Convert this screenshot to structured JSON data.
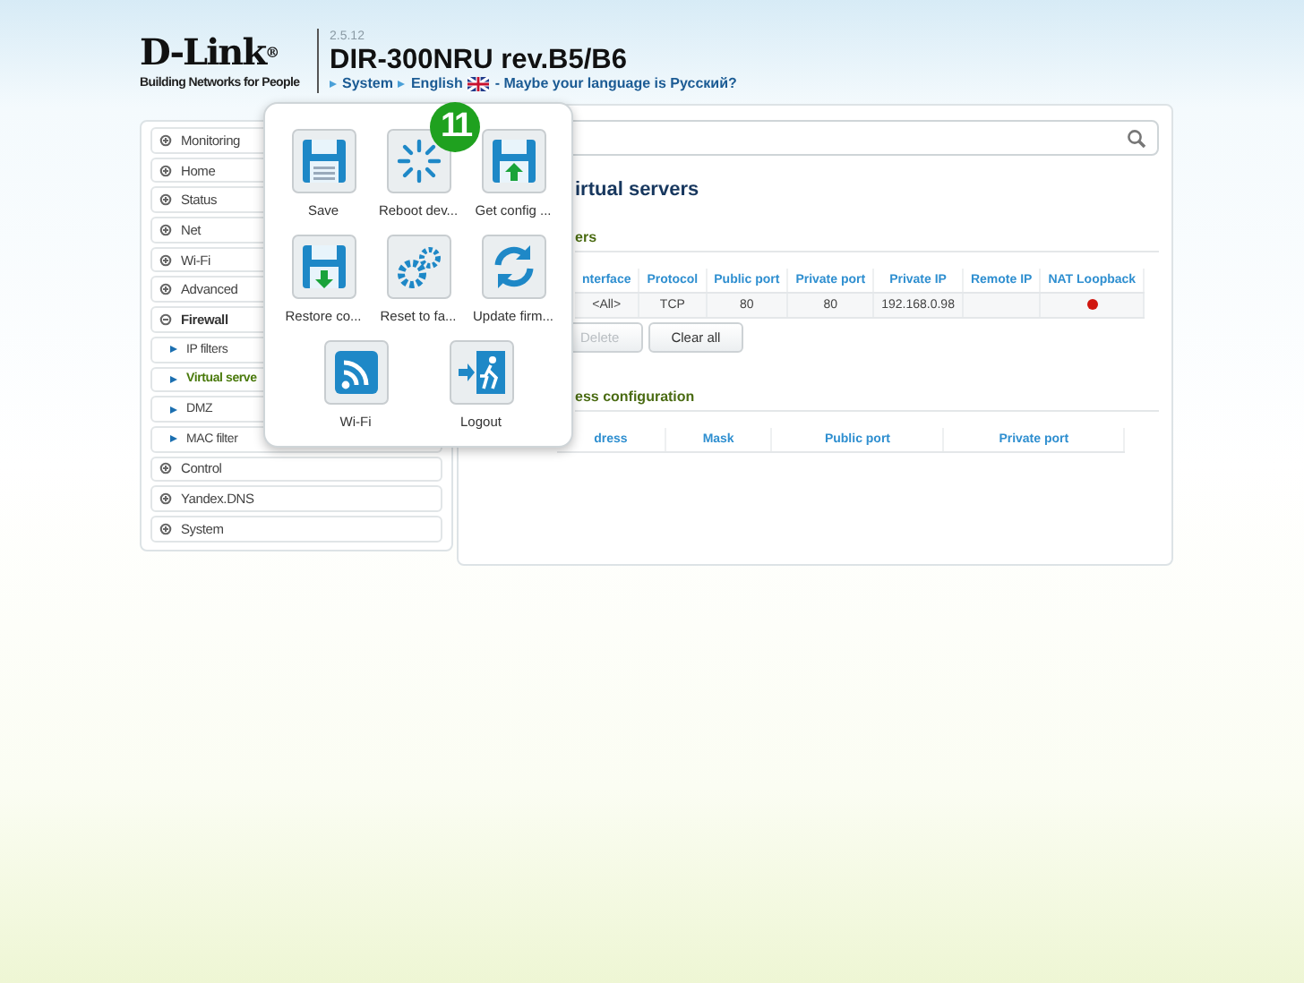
{
  "header": {
    "logo": "D-Link",
    "registered": "®",
    "tagline": "Building Networks for People",
    "version": "2.5.12",
    "model": "DIR-300NRU rev.B5/B6",
    "breadcrumbs": [
      "System",
      "English"
    ],
    "language_hint": "- Maybe your language is Русский?"
  },
  "sidebar": {
    "items": [
      {
        "label": "Monitoring",
        "expanded": false,
        "selected": false
      },
      {
        "label": "Home",
        "expanded": false,
        "selected": false
      },
      {
        "label": "Status",
        "expanded": false,
        "selected": false
      },
      {
        "label": "Net",
        "expanded": false,
        "selected": false
      },
      {
        "label": "Wi-Fi",
        "expanded": false,
        "selected": false
      },
      {
        "label": "Advanced",
        "expanded": false,
        "selected": false
      },
      {
        "label": "Firewall",
        "expanded": true,
        "selected": false,
        "children": [
          {
            "label": "IP filters",
            "selected": false
          },
          {
            "label": "Virtual serve",
            "selected": true
          },
          {
            "label": "DMZ",
            "selected": false
          },
          {
            "label": "MAC filter",
            "selected": false
          }
        ]
      },
      {
        "label": "Control",
        "expanded": false,
        "selected": false
      },
      {
        "label": "Yandex.DNS",
        "expanded": false,
        "selected": false
      },
      {
        "label": "System",
        "expanded": false,
        "selected": false
      }
    ]
  },
  "main": {
    "title": "irtual servers",
    "section": "ers",
    "table": {
      "columns": [
        "nterface",
        "Protocol",
        "Public port",
        "Private port",
        "Private IP",
        "Remote IP",
        "NAT Loopback"
      ],
      "rows": [
        {
          "cells": [
            "<All>",
            "TCP",
            "80",
            "80",
            "192.168.0.98",
            ""
          ],
          "nat_loopback": false
        }
      ]
    },
    "buttons": [
      {
        "label": "Delete",
        "disabled": true
      },
      {
        "label": "Clear all",
        "disabled": false
      }
    ],
    "section_2": "ess configuration",
    "table_2": {
      "columns": [
        "dress",
        "Mask",
        "Public port",
        "Private port"
      ]
    }
  },
  "popup_menu": {
    "items": [
      {
        "label": "Save",
        "kind": "save"
      },
      {
        "label": "Reboot dev...",
        "kind": "reboot"
      },
      {
        "label": "Get config ...",
        "kind": "upload"
      },
      {
        "label": "Restore co...",
        "kind": "download"
      },
      {
        "label": "Reset to fa...",
        "kind": "gears"
      },
      {
        "label": "Update firm...",
        "kind": "refresh"
      },
      {
        "label": "Wi-Fi",
        "kind": "wifi"
      },
      {
        "label": "Logout",
        "kind": "exit"
      }
    ]
  },
  "step_badge": "11"
}
